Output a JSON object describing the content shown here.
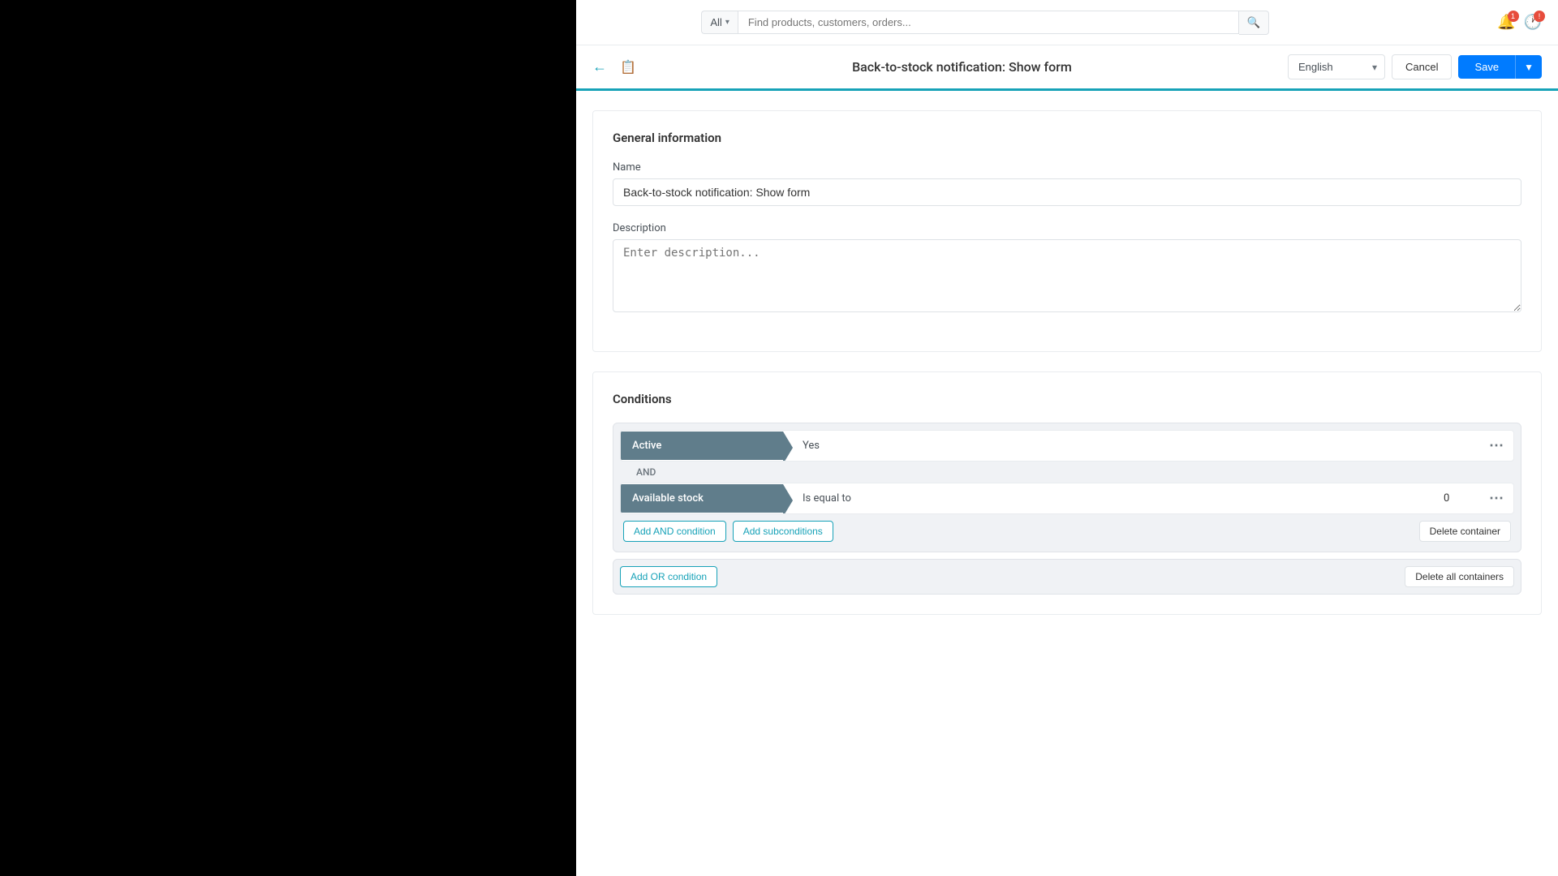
{
  "topNav": {
    "searchFilter": "All",
    "searchPlaceholder": "Find products, customers, orders...",
    "chevron": "▾"
  },
  "subHeader": {
    "title": "Back-to-stock notification: Show form",
    "language": "English",
    "cancelLabel": "Cancel",
    "saveLabel": "Save"
  },
  "generalInfo": {
    "sectionTitle": "General information",
    "nameLabel": "Name",
    "nameValue": "Back-to-stock notification: Show form",
    "descriptionLabel": "Description",
    "descriptionPlaceholder": "Enter description..."
  },
  "conditions": {
    "sectionTitle": "Conditions",
    "block1": {
      "tag1": "Active",
      "operator1": "Yes",
      "andLabel": "AND",
      "tag2": "Available stock",
      "operator2": "Is equal to",
      "value2": "0",
      "addAndConditionLabel": "Add AND condition",
      "addSubconditionsLabel": "Add subconditions",
      "deleteContainerLabel": "Delete container"
    },
    "block2": {
      "addOrConditionLabel": "Add OR condition",
      "deleteAllLabel": "Delete all containers"
    }
  }
}
